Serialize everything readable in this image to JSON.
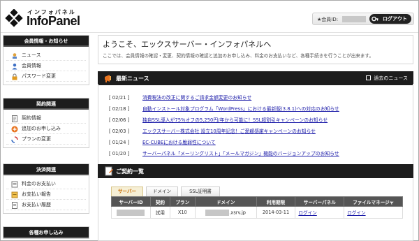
{
  "header": {
    "logo_kana": "インフォパネル",
    "logo_text": "InfoPanel",
    "member_label": "★会員ID:",
    "logout_label": "ログアウト"
  },
  "sidebar": {
    "groups": [
      {
        "title": "会員情報・お知らせ",
        "items": [
          {
            "label": "ニュース",
            "icon": "news-icon"
          },
          {
            "label": "会員情報",
            "icon": "member-icon"
          },
          {
            "label": "パスワード変更",
            "icon": "lock-icon"
          }
        ]
      },
      {
        "title": "契約関連",
        "items": [
          {
            "label": "契約情報",
            "icon": "contract-icon"
          },
          {
            "label": "追加のお申し込み",
            "icon": "add-icon"
          },
          {
            "label": "プランの変更",
            "icon": "refresh-icon"
          }
        ]
      },
      {
        "title": "決済関連",
        "items": [
          {
            "label": "料金のお支払い",
            "icon": "payment-icon"
          },
          {
            "label": "お支払い報告",
            "icon": "report-icon"
          },
          {
            "label": "お支払い履歴",
            "icon": "history-icon"
          }
        ]
      },
      {
        "title": "各種お申し込み",
        "items": []
      }
    ]
  },
  "welcome": {
    "title": "ようこそ、エックスサーバー・インフォパネルへ",
    "description": "ここでは、会員情報の確認・変更、契約情報の確認と追加のお申し込み、料金のお支払いなど、各種手続きを行うことが出来ます。"
  },
  "news": {
    "title": "最新ニュース",
    "archive_label": "過去のニュース",
    "items": [
      {
        "date": "[ 02/21 ]",
        "text": "消費税法の改正に関するご請求金額変更のお知らせ"
      },
      {
        "date": "[ 02/18 ]",
        "text": "自動インストール対象プログラム「WordPress」における最新版(3.8.1)への対応のお知らせ"
      },
      {
        "date": "[ 02/06 ]",
        "text": "独自SSL導入が75%オフの5,250円/年から可能に！SSL超割引キャンペーンのお知らせ"
      },
      {
        "date": "[ 02/03 ]",
        "text": "エックスサーバー株式会社 設立10周年記念！ご愛顧感謝キャンペーンのお知らせ"
      },
      {
        "date": "[ 01/24 ]",
        "text": "EC-CUBEにおける脆弱性について"
      },
      {
        "date": "[ 01/20 ]",
        "text": "サーバーパネル「メーリングリスト」「メールマガジン」機能のバージョンアップのお知らせ"
      }
    ]
  },
  "contracts": {
    "title": "ご契約一覧",
    "tabs": [
      "サーバー",
      "ドメイン",
      "SSL証明書"
    ],
    "columns": [
      "サーバーID",
      "契約",
      "プラン",
      "ドメイン",
      "利用期限",
      "サーバーパネル",
      "ファイルマネージャ"
    ],
    "rows": [
      {
        "contract": "試用",
        "plan": "X10",
        "domain_suffix": ".xsrv.jp",
        "expiry": "2014-03-11",
        "panel": "ログイン",
        "filemanager": "ログイン"
      }
    ]
  }
}
